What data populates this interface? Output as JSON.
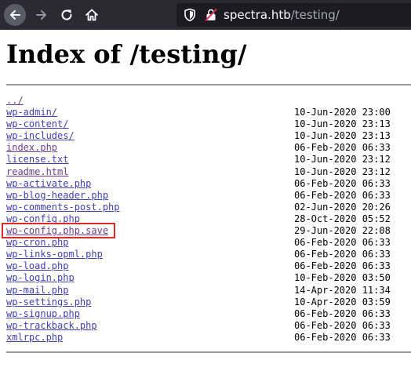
{
  "browser": {
    "url_domain": "spectra.htb",
    "url_path": "/testing/"
  },
  "page": {
    "title": "Index of /testing/"
  },
  "listing": [
    {
      "name": "../",
      "date": "",
      "visited": true
    },
    {
      "name": "wp-admin/",
      "date": "10-Jun-2020 23:00",
      "visited": false
    },
    {
      "name": "wp-content/",
      "date": "10-Jun-2020 23:13",
      "visited": false
    },
    {
      "name": "wp-includes/",
      "date": "10-Jun-2020 23:13",
      "visited": false
    },
    {
      "name": "index.php",
      "date": "06-Feb-2020 06:33",
      "visited": true
    },
    {
      "name": "license.txt",
      "date": "10-Jun-2020 23:12",
      "visited": false
    },
    {
      "name": "readme.html",
      "date": "10-Jun-2020 23:12",
      "visited": true
    },
    {
      "name": "wp-activate.php",
      "date": "06-Feb-2020 06:33",
      "visited": false
    },
    {
      "name": "wp-blog-header.php",
      "date": "06-Feb-2020 06:33",
      "visited": false
    },
    {
      "name": "wp-comments-post.php",
      "date": "02-Jun-2020 20:26",
      "visited": false
    },
    {
      "name": "wp-config.php",
      "date": "28-Oct-2020 05:52",
      "visited": false
    },
    {
      "name": "wp-config.php.save",
      "date": "29-Jun-2020 22:08",
      "visited": true
    },
    {
      "name": "wp-cron.php",
      "date": "06-Feb-2020 06:33",
      "visited": false
    },
    {
      "name": "wp-links-opml.php",
      "date": "06-Feb-2020 06:33",
      "visited": false
    },
    {
      "name": "wp-load.php",
      "date": "06-Feb-2020 06:33",
      "visited": false
    },
    {
      "name": "wp-login.php",
      "date": "10-Feb-2020 03:50",
      "visited": false
    },
    {
      "name": "wp-mail.php",
      "date": "14-Apr-2020 11:34",
      "visited": false
    },
    {
      "name": "wp-settings.php",
      "date": "10-Apr-2020 03:59",
      "visited": false
    },
    {
      "name": "wp-signup.php",
      "date": "06-Feb-2020 06:33",
      "visited": false
    },
    {
      "name": "wp-trackback.php",
      "date": "06-Feb-2020 06:33",
      "visited": false
    },
    {
      "name": "xmlrpc.php",
      "date": "06-Feb-2020 06:33",
      "visited": false
    }
  ],
  "icons": [
    "arrow-left-icon",
    "arrow-right-icon",
    "reload-icon",
    "home-icon",
    "shield-icon",
    "insecure-lock-icon"
  ],
  "colors": {
    "toolbar": "#2b2a33",
    "urlbar": "#1c1b22",
    "link": "#3f3fae",
    "visited_link": "#6d3b86",
    "highlight": "#d92b2b"
  }
}
